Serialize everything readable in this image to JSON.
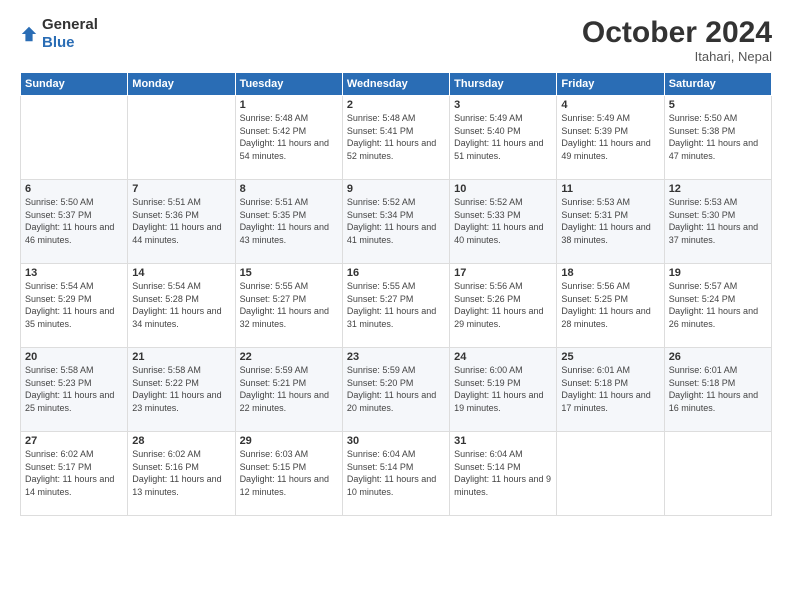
{
  "logo": {
    "general": "General",
    "blue": "Blue"
  },
  "header": {
    "month": "October 2024",
    "location": "Itahari, Nepal"
  },
  "weekdays": [
    "Sunday",
    "Monday",
    "Tuesday",
    "Wednesday",
    "Thursday",
    "Friday",
    "Saturday"
  ],
  "weeks": [
    [
      {
        "day": "",
        "sunrise": "",
        "sunset": "",
        "daylight": ""
      },
      {
        "day": "",
        "sunrise": "",
        "sunset": "",
        "daylight": ""
      },
      {
        "day": "1",
        "sunrise": "Sunrise: 5:48 AM",
        "sunset": "Sunset: 5:42 PM",
        "daylight": "Daylight: 11 hours and 54 minutes."
      },
      {
        "day": "2",
        "sunrise": "Sunrise: 5:48 AM",
        "sunset": "Sunset: 5:41 PM",
        "daylight": "Daylight: 11 hours and 52 minutes."
      },
      {
        "day": "3",
        "sunrise": "Sunrise: 5:49 AM",
        "sunset": "Sunset: 5:40 PM",
        "daylight": "Daylight: 11 hours and 51 minutes."
      },
      {
        "day": "4",
        "sunrise": "Sunrise: 5:49 AM",
        "sunset": "Sunset: 5:39 PM",
        "daylight": "Daylight: 11 hours and 49 minutes."
      },
      {
        "day": "5",
        "sunrise": "Sunrise: 5:50 AM",
        "sunset": "Sunset: 5:38 PM",
        "daylight": "Daylight: 11 hours and 47 minutes."
      }
    ],
    [
      {
        "day": "6",
        "sunrise": "Sunrise: 5:50 AM",
        "sunset": "Sunset: 5:37 PM",
        "daylight": "Daylight: 11 hours and 46 minutes."
      },
      {
        "day": "7",
        "sunrise": "Sunrise: 5:51 AM",
        "sunset": "Sunset: 5:36 PM",
        "daylight": "Daylight: 11 hours and 44 minutes."
      },
      {
        "day": "8",
        "sunrise": "Sunrise: 5:51 AM",
        "sunset": "Sunset: 5:35 PM",
        "daylight": "Daylight: 11 hours and 43 minutes."
      },
      {
        "day": "9",
        "sunrise": "Sunrise: 5:52 AM",
        "sunset": "Sunset: 5:34 PM",
        "daylight": "Daylight: 11 hours and 41 minutes."
      },
      {
        "day": "10",
        "sunrise": "Sunrise: 5:52 AM",
        "sunset": "Sunset: 5:33 PM",
        "daylight": "Daylight: 11 hours and 40 minutes."
      },
      {
        "day": "11",
        "sunrise": "Sunrise: 5:53 AM",
        "sunset": "Sunset: 5:31 PM",
        "daylight": "Daylight: 11 hours and 38 minutes."
      },
      {
        "day": "12",
        "sunrise": "Sunrise: 5:53 AM",
        "sunset": "Sunset: 5:30 PM",
        "daylight": "Daylight: 11 hours and 37 minutes."
      }
    ],
    [
      {
        "day": "13",
        "sunrise": "Sunrise: 5:54 AM",
        "sunset": "Sunset: 5:29 PM",
        "daylight": "Daylight: 11 hours and 35 minutes."
      },
      {
        "day": "14",
        "sunrise": "Sunrise: 5:54 AM",
        "sunset": "Sunset: 5:28 PM",
        "daylight": "Daylight: 11 hours and 34 minutes."
      },
      {
        "day": "15",
        "sunrise": "Sunrise: 5:55 AM",
        "sunset": "Sunset: 5:27 PM",
        "daylight": "Daylight: 11 hours and 32 minutes."
      },
      {
        "day": "16",
        "sunrise": "Sunrise: 5:55 AM",
        "sunset": "Sunset: 5:27 PM",
        "daylight": "Daylight: 11 hours and 31 minutes."
      },
      {
        "day": "17",
        "sunrise": "Sunrise: 5:56 AM",
        "sunset": "Sunset: 5:26 PM",
        "daylight": "Daylight: 11 hours and 29 minutes."
      },
      {
        "day": "18",
        "sunrise": "Sunrise: 5:56 AM",
        "sunset": "Sunset: 5:25 PM",
        "daylight": "Daylight: 11 hours and 28 minutes."
      },
      {
        "day": "19",
        "sunrise": "Sunrise: 5:57 AM",
        "sunset": "Sunset: 5:24 PM",
        "daylight": "Daylight: 11 hours and 26 minutes."
      }
    ],
    [
      {
        "day": "20",
        "sunrise": "Sunrise: 5:58 AM",
        "sunset": "Sunset: 5:23 PM",
        "daylight": "Daylight: 11 hours and 25 minutes."
      },
      {
        "day": "21",
        "sunrise": "Sunrise: 5:58 AM",
        "sunset": "Sunset: 5:22 PM",
        "daylight": "Daylight: 11 hours and 23 minutes."
      },
      {
        "day": "22",
        "sunrise": "Sunrise: 5:59 AM",
        "sunset": "Sunset: 5:21 PM",
        "daylight": "Daylight: 11 hours and 22 minutes."
      },
      {
        "day": "23",
        "sunrise": "Sunrise: 5:59 AM",
        "sunset": "Sunset: 5:20 PM",
        "daylight": "Daylight: 11 hours and 20 minutes."
      },
      {
        "day": "24",
        "sunrise": "Sunrise: 6:00 AM",
        "sunset": "Sunset: 5:19 PM",
        "daylight": "Daylight: 11 hours and 19 minutes."
      },
      {
        "day": "25",
        "sunrise": "Sunrise: 6:01 AM",
        "sunset": "Sunset: 5:18 PM",
        "daylight": "Daylight: 11 hours and 17 minutes."
      },
      {
        "day": "26",
        "sunrise": "Sunrise: 6:01 AM",
        "sunset": "Sunset: 5:18 PM",
        "daylight": "Daylight: 11 hours and 16 minutes."
      }
    ],
    [
      {
        "day": "27",
        "sunrise": "Sunrise: 6:02 AM",
        "sunset": "Sunset: 5:17 PM",
        "daylight": "Daylight: 11 hours and 14 minutes."
      },
      {
        "day": "28",
        "sunrise": "Sunrise: 6:02 AM",
        "sunset": "Sunset: 5:16 PM",
        "daylight": "Daylight: 11 hours and 13 minutes."
      },
      {
        "day": "29",
        "sunrise": "Sunrise: 6:03 AM",
        "sunset": "Sunset: 5:15 PM",
        "daylight": "Daylight: 11 hours and 12 minutes."
      },
      {
        "day": "30",
        "sunrise": "Sunrise: 6:04 AM",
        "sunset": "Sunset: 5:14 PM",
        "daylight": "Daylight: 11 hours and 10 minutes."
      },
      {
        "day": "31",
        "sunrise": "Sunrise: 6:04 AM",
        "sunset": "Sunset: 5:14 PM",
        "daylight": "Daylight: 11 hours and 9 minutes."
      },
      {
        "day": "",
        "sunrise": "",
        "sunset": "",
        "daylight": ""
      },
      {
        "day": "",
        "sunrise": "",
        "sunset": "",
        "daylight": ""
      }
    ]
  ]
}
